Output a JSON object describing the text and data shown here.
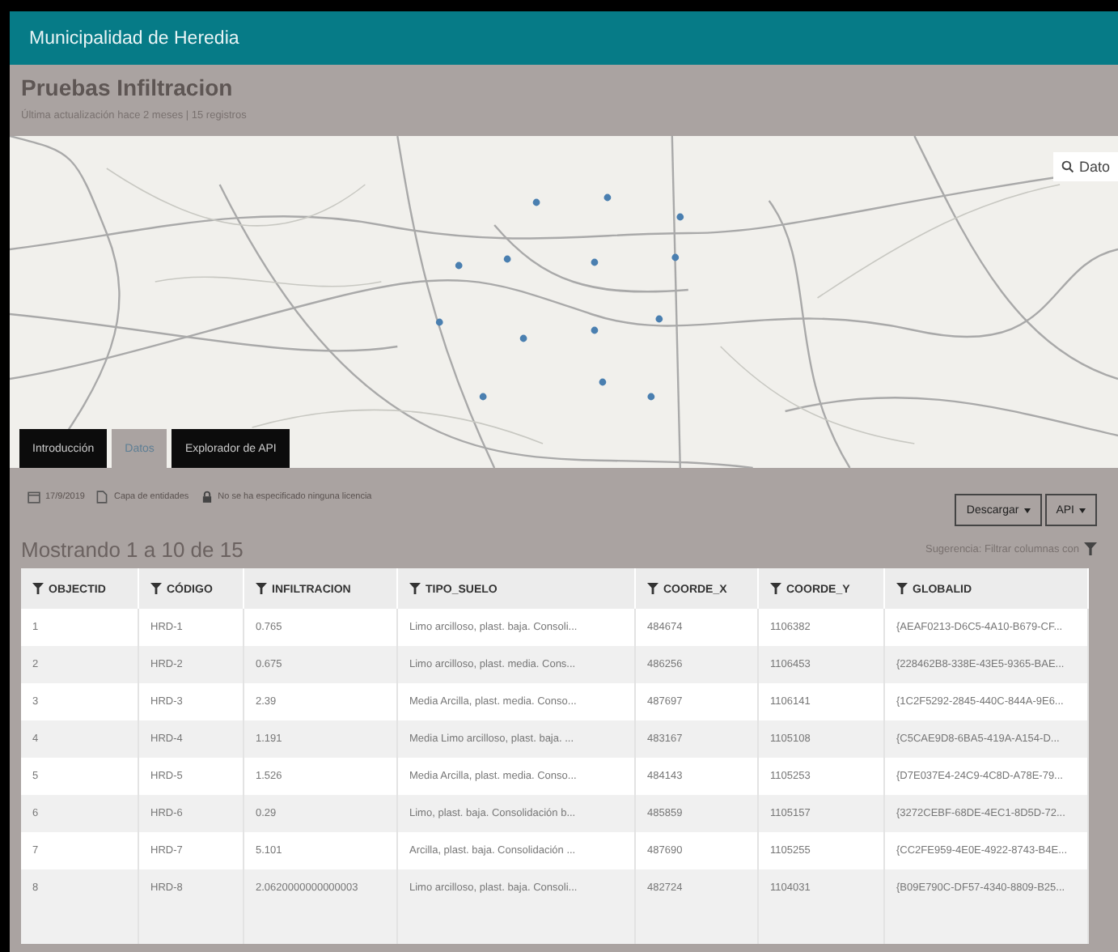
{
  "header": {
    "title": "Municipalidad de Heredia"
  },
  "dataset": {
    "title": "Pruebas Infiltracion",
    "subtitle": "Última actualización hace 2 meses | 15 registros"
  },
  "map": {
    "search": {
      "placeholder": "Dato"
    }
  },
  "tabs": [
    {
      "label": "Introducción",
      "selected": false
    },
    {
      "label": "Datos",
      "selected": true
    },
    {
      "label": "Explorador de API",
      "selected": false
    }
  ],
  "info": {
    "date": "17/9/2019",
    "type": "Capa de entidades",
    "license": "No se ha especificado ninguna licencia"
  },
  "buttons": [
    {
      "label": "Descargar"
    },
    {
      "label": "API"
    }
  ],
  "showing": "Mostrando 1 a 10 de 15",
  "hint": "Sugerencia: Filtrar columnas con",
  "table": {
    "columns": [
      "OBJECTID",
      "CÓDIGO",
      "INFILTRACION",
      "TIPO_SUELO",
      "COORDE_X",
      "COORDE_Y",
      "GLOBALID"
    ],
    "rows": [
      [
        "1",
        "HRD-1",
        "0.765",
        "Limo arcilloso, plast. baja. Consoli...",
        "484674",
        "1106382",
        "{AEAF0213-D6C5-4A10-B679-CF..."
      ],
      [
        "2",
        "HRD-2",
        "0.675",
        "Limo arcilloso, plast. media. Cons...",
        "486256",
        "1106453",
        "{228462B8-338E-43E5-9365-BAE..."
      ],
      [
        "3",
        "HRD-3",
        "2.39",
        "Media Arcilla, plast. media. Conso...",
        "487697",
        "1106141",
        "{1C2F5292-2845-440C-844A-9E6..."
      ],
      [
        "4",
        "HRD-4",
        "1.191",
        "Media Limo arcilloso, plast. baja. ...",
        "483167",
        "1105108",
        "{C5CAE9D8-6BA5-419A-A154-D..."
      ],
      [
        "5",
        "HRD-5",
        "1.526",
        "Media Arcilla, plast. media. Conso...",
        "484143",
        "1105253",
        "{D7E037E4-24C9-4C8D-A78E-79..."
      ],
      [
        "6",
        "HRD-6",
        "0.29",
        "Limo, plast. baja. Consolidación b...",
        "485859",
        "1105157",
        "{3272CEBF-68DE-4EC1-8D5D-72..."
      ],
      [
        "7",
        "HRD-7",
        "5.101",
        "Arcilla, plast. baja. Consolidación ...",
        "487690",
        "1105255",
        "{CC2FE959-4E0E-4922-8743-B4E..."
      ],
      [
        "8",
        "HRD-8",
        "2.0620000000000003",
        "Limo arcilloso, plast. baja. Consoli...",
        "482724",
        "1104031",
        "{B09E790C-DF57-4340-8809-B25..."
      ]
    ]
  }
}
